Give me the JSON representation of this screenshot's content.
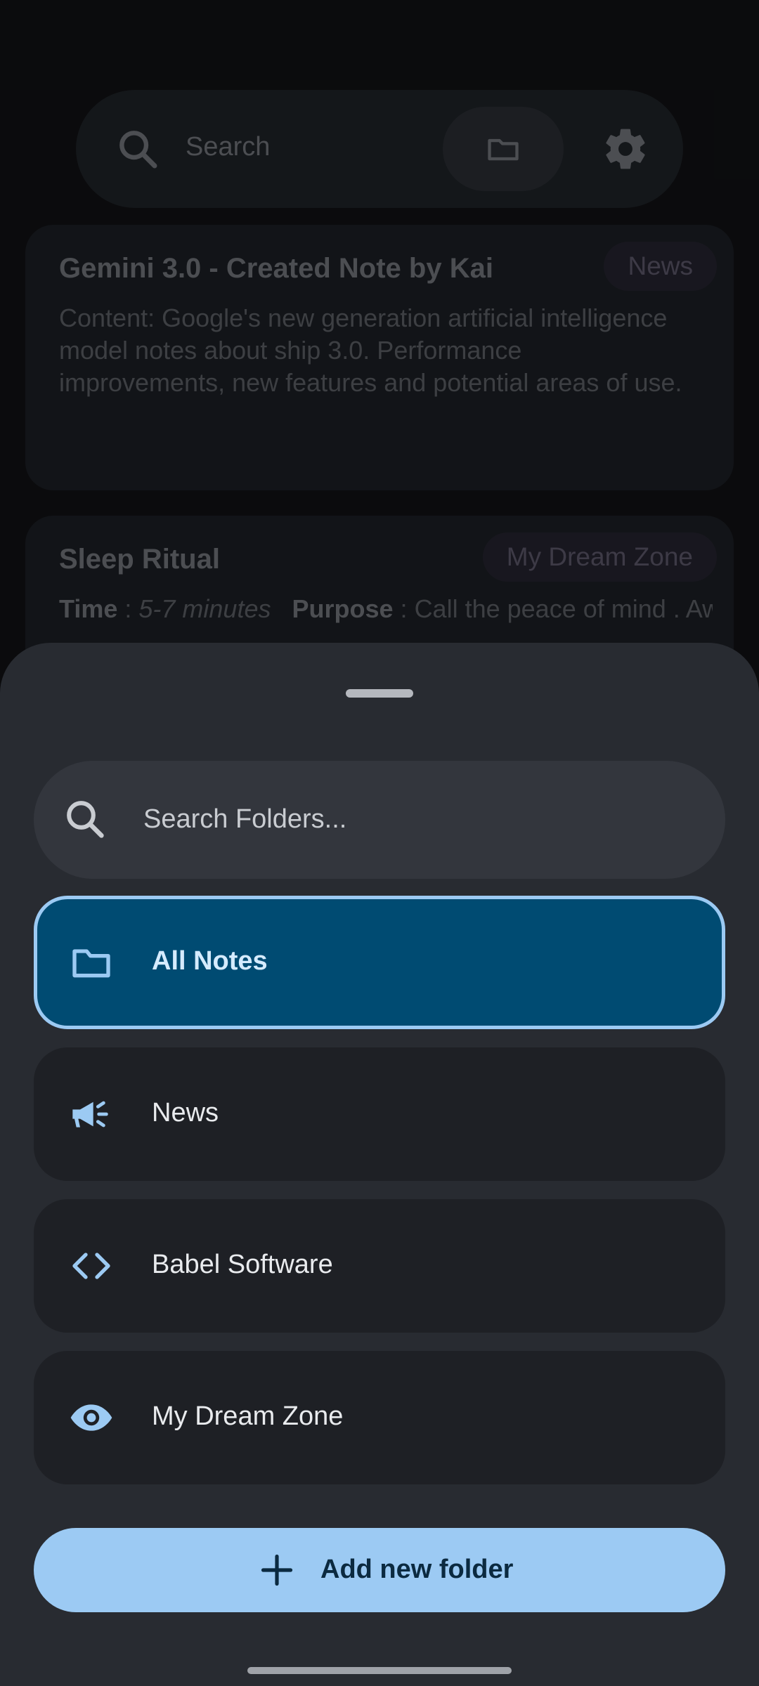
{
  "background": {
    "search_placeholder": "Search",
    "icons": {
      "search": "search-icon",
      "folder": "folder-icon",
      "settings": "gear-icon"
    },
    "notes": [
      {
        "title": "Gemini 3.0 - Created Note by Kai",
        "tag": "News",
        "body": "Content: Google's new generation artificial intelligence model notes about ship 3.0. Performance improvements, new features and potential areas of use."
      },
      {
        "title": "Sleep Ritual",
        "tag": "My Dream Zone",
        "time_label": "Time",
        "time_value": "5-7 minutes",
        "purpose_label": "Purpose",
        "purpose_value": "Call the peace of mind . Awareness and increase the possibility of"
      }
    ]
  },
  "sheet": {
    "search_placeholder": "Search Folders...",
    "folders": [
      {
        "label": "All Notes",
        "icon": "folder-icon",
        "selected": true
      },
      {
        "label": "News",
        "icon": "megaphone-icon",
        "selected": false
      },
      {
        "label": "Babel Software",
        "icon": "code-icon",
        "selected": false
      },
      {
        "label": "My Dream Zone",
        "icon": "eye-icon",
        "selected": false
      }
    ],
    "add_button_label": "Add new folder"
  },
  "colors": {
    "accent": "#9ccaf3",
    "selected_bg": "#004b72",
    "sheet_bg": "#282b31",
    "item_bg": "#1e2025"
  }
}
